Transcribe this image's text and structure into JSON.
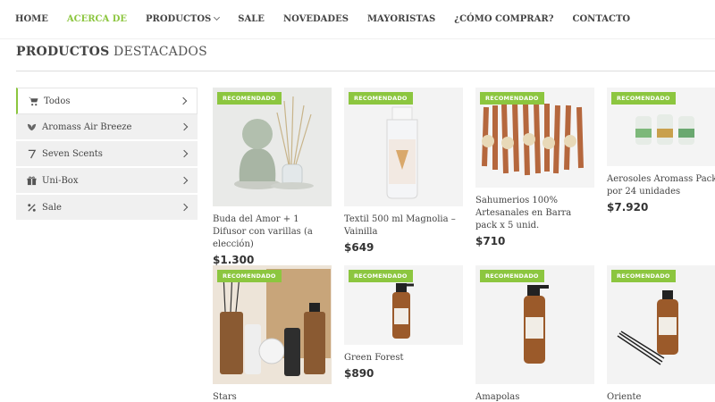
{
  "nav": {
    "items": [
      {
        "label": "HOME"
      },
      {
        "label": "ACERCA DE"
      },
      {
        "label": "PRODUCTOS"
      },
      {
        "label": "SALE"
      },
      {
        "label": "NOVEDADES"
      },
      {
        "label": "MAYORISTAS"
      },
      {
        "label": "¿CÓMO COMPRAR?"
      },
      {
        "label": "CONTACTO"
      }
    ],
    "active_color": "#8cc63f"
  },
  "section": {
    "title_bold": "PRODUCTOS",
    "title_rest": "DESTACADOS"
  },
  "sidebar": {
    "items": [
      {
        "label": "Todos",
        "icon": "cart-icon"
      },
      {
        "label": "Aromass Air Breeze",
        "icon": "leaf-icon"
      },
      {
        "label": "Seven Scents",
        "icon": "seven-icon"
      },
      {
        "label": "Uni-Box",
        "icon": "gift-icon"
      },
      {
        "label": "Sale",
        "icon": "percent-icon"
      }
    ]
  },
  "products": [
    {
      "badge": "RECOMENDADO",
      "name": "Buda del Amor + 1 Difusor con varillas (a elección)",
      "price": "$1.300"
    },
    {
      "badge": "RECOMENDADO",
      "name": "Textil 500 ml Magnolia – Vainilla",
      "price": "$649"
    },
    {
      "badge": "RECOMENDADO",
      "name": "Sahumerios 100% Artesanales en Barra pack x 5 unid.",
      "price": "$710"
    },
    {
      "badge": "RECOMENDADO",
      "name": "Aerosoles Aromass Pack por 24 unidades",
      "price": "$7.920"
    },
    {
      "badge": "RECOMENDADO",
      "name": "Stars",
      "price": ""
    },
    {
      "badge": "RECOMENDADO",
      "name": "Green Forest",
      "price": "$890"
    },
    {
      "badge": "RECOMENDADO",
      "name": "Amapolas",
      "price": ""
    },
    {
      "badge": "RECOMENDADO",
      "name": "Oriente",
      "price": ""
    }
  ],
  "colors": {
    "accent": "#8cc63f"
  }
}
